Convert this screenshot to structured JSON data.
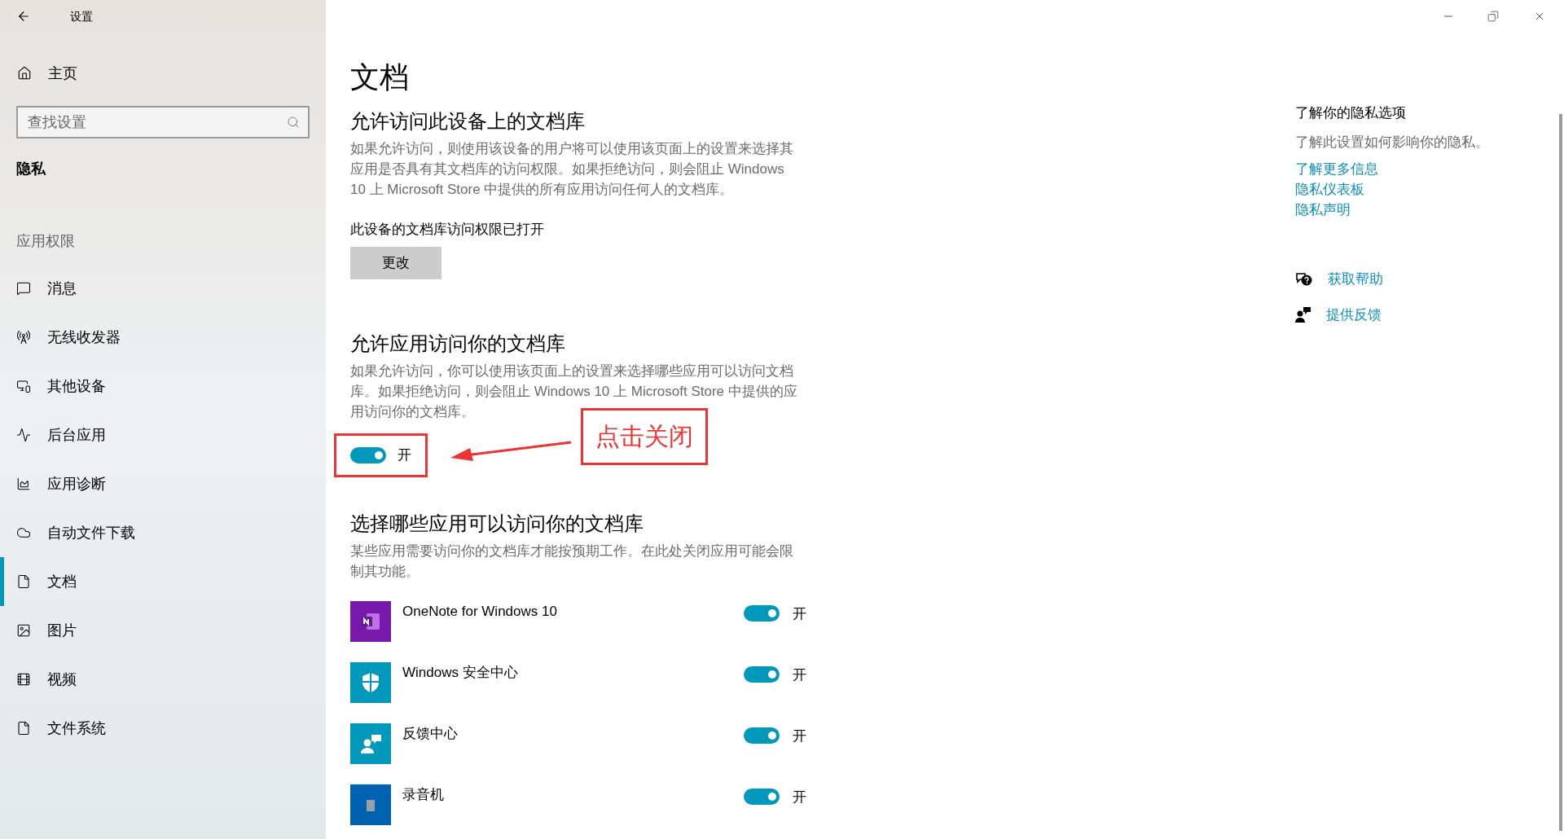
{
  "window": {
    "title": "设置"
  },
  "sidebar": {
    "home": "主页",
    "search": {
      "placeholder": "查找设置"
    },
    "category": "隐私",
    "section": "应用权限",
    "items": [
      {
        "label": "消息",
        "kind": "message",
        "selected": false
      },
      {
        "label": "无线收发器",
        "kind": "radio",
        "selected": false
      },
      {
        "label": "其他设备",
        "kind": "devices",
        "selected": false
      },
      {
        "label": "后台应用",
        "kind": "background",
        "selected": false
      },
      {
        "label": "应用诊断",
        "kind": "diagnostics",
        "selected": false
      },
      {
        "label": "自动文件下载",
        "kind": "cloud",
        "selected": false
      },
      {
        "label": "文档",
        "kind": "document",
        "selected": true
      },
      {
        "label": "图片",
        "kind": "image",
        "selected": false
      },
      {
        "label": "视频",
        "kind": "video",
        "selected": false
      },
      {
        "label": "文件系统",
        "kind": "document",
        "selected": false
      }
    ]
  },
  "page": {
    "title": "文档",
    "device_section": {
      "heading": "允许访问此设备上的文档库",
      "description": "如果允许访问，则使用该设备的用户将可以使用该页面上的设置来选择其应用是否具有其文档库的访问权限。如果拒绝访问，则会阻止 Windows 10 上 Microsoft Store 中提供的所有应用访问任何人的文档库。",
      "status": "此设备的文档库访问权限已打开",
      "button": "更改"
    },
    "apps_section": {
      "heading": "允许应用访问你的文档库",
      "description": "如果允许访问，你可以使用该页面上的设置来选择哪些应用可以访问文档库。如果拒绝访问，则会阻止 Windows 10 上 Microsoft Store 中提供的应用访问你的文档库。",
      "toggle": {
        "on": true,
        "label": "开"
      },
      "annotation": "点击关闭"
    },
    "choose_section": {
      "heading": "选择哪些应用可以访问你的文档库",
      "description": "某些应用需要访问你的文档库才能按预期工作。在此处关闭应用可能会限制其功能。",
      "apps": [
        {
          "name": "OneNote for Windows 10",
          "kind": "onenote",
          "color": "#7719aa",
          "on": true,
          "label": "开"
        },
        {
          "name": "Windows 安全中心",
          "kind": "shield",
          "color": "#0099bc",
          "on": true,
          "label": "开"
        },
        {
          "name": "反馈中心",
          "kind": "feedback",
          "color": "#0099bc",
          "on": true,
          "label": "开"
        },
        {
          "name": "录音机",
          "kind": "recorder",
          "color": "#0063b1",
          "on": true,
          "label": "开"
        }
      ]
    }
  },
  "aside": {
    "heading": "了解你的隐私选项",
    "description": "了解此设置如何影响你的隐私。",
    "links": [
      "了解更多信息",
      "隐私仪表板",
      "隐私声明"
    ],
    "actions": [
      {
        "label": "获取帮助",
        "kind": "help"
      },
      {
        "label": "提供反馈",
        "kind": "feedback"
      }
    ]
  }
}
